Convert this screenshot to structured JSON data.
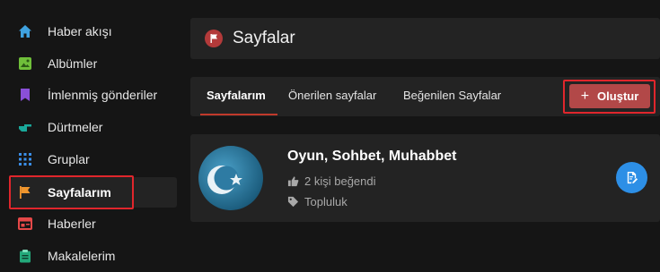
{
  "sidebar": {
    "items": [
      {
        "label": "Haber akışı",
        "icon": "home-icon"
      },
      {
        "label": "Albümler",
        "icon": "image-icon"
      },
      {
        "label": "İmlenmiş gönderiler",
        "icon": "bookmark-icon"
      },
      {
        "label": "Dürtmeler",
        "icon": "poke-hand-icon"
      },
      {
        "label": "Gruplar",
        "icon": "group-grid-icon"
      },
      {
        "label": "Sayfalarım",
        "icon": "flag-icon",
        "active": true
      },
      {
        "label": "Haberler",
        "icon": "news-icon"
      },
      {
        "label": "Makalelerim",
        "icon": "clipboard-icon"
      }
    ]
  },
  "header": {
    "title": "Sayfalar",
    "icon": "flag-icon"
  },
  "tabs": [
    {
      "label": "Sayfalarım",
      "active": true
    },
    {
      "label": "Önerilen sayfalar"
    },
    {
      "label": "Beğenilen Sayfalar"
    }
  ],
  "create_button": {
    "label": "Oluştur",
    "icon": "plus-icon"
  },
  "page": {
    "name": "Oyun, Sohbet, Muhabbet",
    "likes": "2 kişi beğendi",
    "category": "Topluluk"
  },
  "colors": {
    "accent": "#b24848",
    "highlight": "#e0262c",
    "edit_button": "#2d8fe6"
  }
}
